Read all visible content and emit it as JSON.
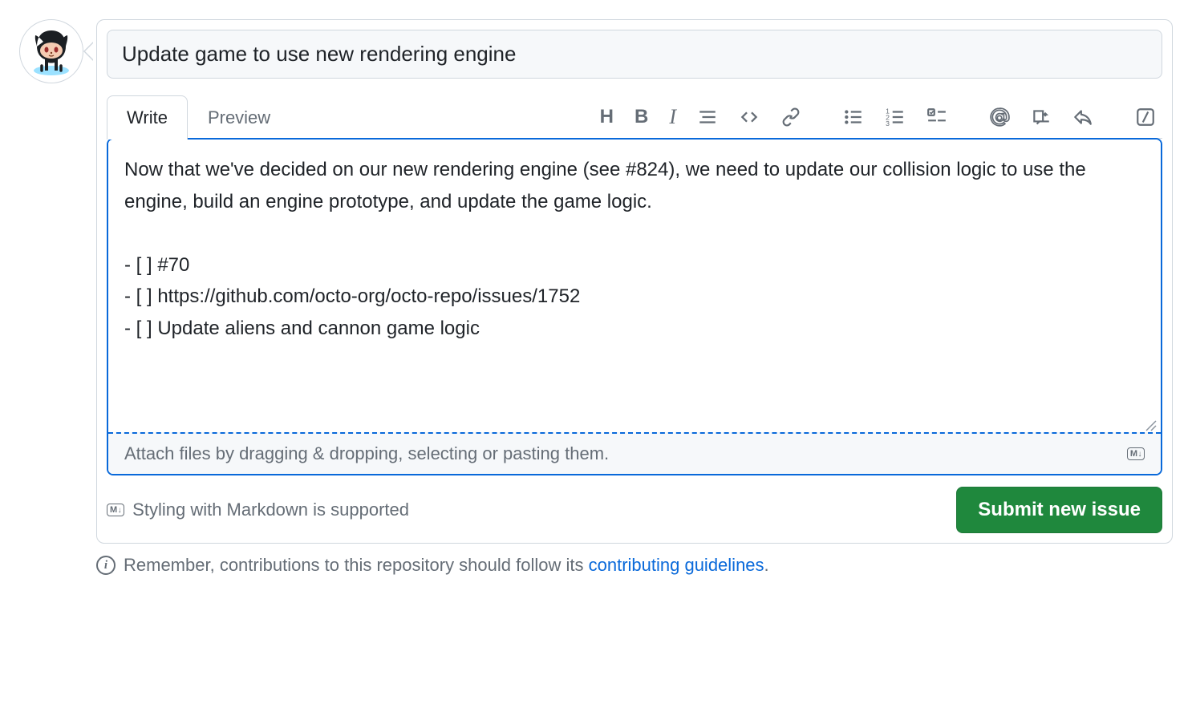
{
  "issue": {
    "title": "Update game to use new rendering engine",
    "body": "Now that we've decided on our new rendering engine (see #824), we need to update our collision logic to use the engine, build an engine prototype, and update the game logic.\n\n- [ ] #70\n- [ ] https://github.com/octo-org/octo-repo/issues/1752\n- [ ] Update aliens and cannon game logic"
  },
  "tabs": {
    "write": "Write",
    "preview": "Preview"
  },
  "toolbar": {
    "heading": "H",
    "bold": "B",
    "italic": "I"
  },
  "attach": {
    "hint": "Attach files by dragging & dropping, selecting or pasting them.",
    "badge": "M↓"
  },
  "footer": {
    "styling_hint": "Styling with Markdown is supported",
    "submit_label": "Submit new issue"
  },
  "info": {
    "prefix": "Remember, contributions to this repository should follow its ",
    "link_text": "contributing guidelines",
    "suffix": "."
  }
}
